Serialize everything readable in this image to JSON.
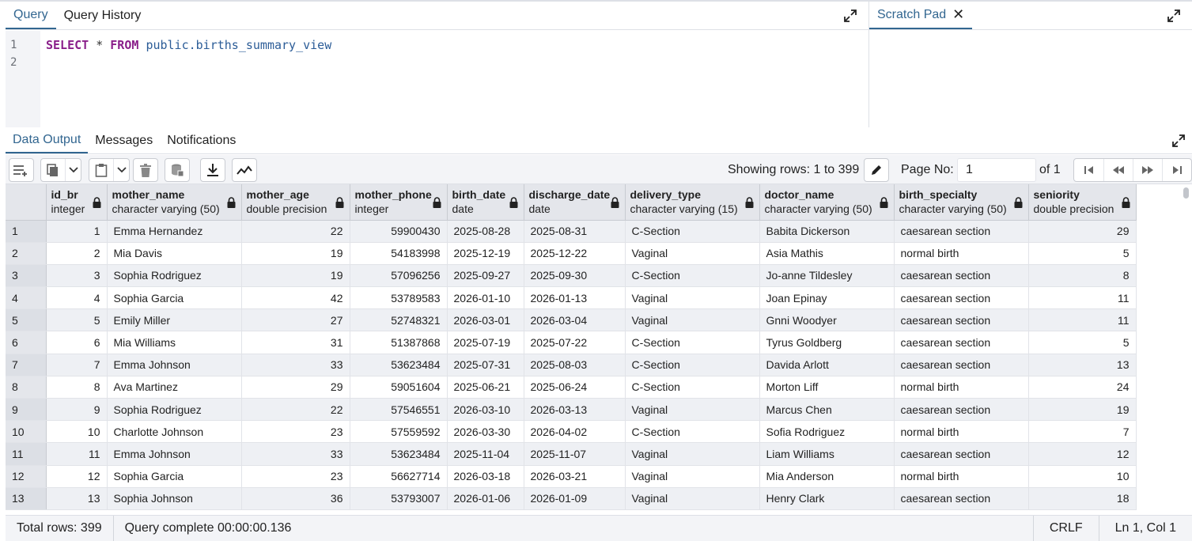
{
  "query_panel": {
    "tabs": [
      {
        "label": "Query",
        "active": true
      },
      {
        "label": "Query History",
        "active": false
      }
    ]
  },
  "scratch_panel": {
    "tab_label": "Scratch Pad"
  },
  "editor": {
    "line_numbers": [
      "1",
      "2"
    ],
    "sql_keyword_select": "SELECT",
    "sql_star": "*",
    "sql_keyword_from": "FROM",
    "sql_object": "public.births_summary_view"
  },
  "output_panel": {
    "tabs": [
      {
        "label": "Data Output",
        "active": true
      },
      {
        "label": "Messages",
        "active": false
      },
      {
        "label": "Notifications",
        "active": false
      }
    ]
  },
  "toolbar": {
    "showing_rows": "Showing rows: 1 to 399",
    "page_label": "Page No:",
    "page_value": "1",
    "of_label": "of 1"
  },
  "grid": {
    "columns": [
      {
        "name": "id_br",
        "type": "integer",
        "align": "right"
      },
      {
        "name": "mother_name",
        "type": "character varying (50)",
        "align": "left"
      },
      {
        "name": "mother_age",
        "type": "double precision",
        "align": "right"
      },
      {
        "name": "mother_phone",
        "type": "integer",
        "align": "right"
      },
      {
        "name": "birth_date",
        "type": "date",
        "align": "left"
      },
      {
        "name": "discharge_date",
        "type": "date",
        "align": "left"
      },
      {
        "name": "delivery_type",
        "type": "character varying (15)",
        "align": "left"
      },
      {
        "name": "doctor_name",
        "type": "character varying (50)",
        "align": "left"
      },
      {
        "name": "birth_specialty",
        "type": "character varying (50)",
        "align": "left"
      },
      {
        "name": "seniority",
        "type": "double precision",
        "align": "right"
      }
    ],
    "rows": [
      [
        "1",
        "1",
        "Emma Hernandez",
        "22",
        "59900430",
        "2025-08-28",
        "2025-08-31",
        "C-Section",
        "Babita Dickerson",
        "caesarean section",
        "29"
      ],
      [
        "2",
        "2",
        "Mia Davis",
        "19",
        "54183998",
        "2025-12-19",
        "2025-12-22",
        "Vaginal",
        "Asia Mathis",
        "normal birth",
        "5"
      ],
      [
        "3",
        "3",
        "Sophia Rodriguez",
        "19",
        "57096256",
        "2025-09-27",
        "2025-09-30",
        "C-Section",
        "Jo-anne Tildesley",
        "caesarean section",
        "8"
      ],
      [
        "4",
        "4",
        "Sophia Garcia",
        "42",
        "53789583",
        "2026-01-10",
        "2026-01-13",
        "Vaginal",
        "Joan Epinay",
        "caesarean section",
        "11"
      ],
      [
        "5",
        "5",
        "Emily Miller",
        "27",
        "52748321",
        "2026-03-01",
        "2026-03-04",
        "Vaginal",
        "Gnni Woodyer",
        "caesarean section",
        "11"
      ],
      [
        "6",
        "6",
        "Mia Williams",
        "31",
        "51387868",
        "2025-07-19",
        "2025-07-22",
        "C-Section",
        "Tyrus Goldberg",
        "caesarean section",
        "5"
      ],
      [
        "7",
        "7",
        "Emma Johnson",
        "33",
        "53623484",
        "2025-07-31",
        "2025-08-03",
        "C-Section",
        "Davida Arlott",
        "caesarean section",
        "13"
      ],
      [
        "8",
        "8",
        "Ava Martinez",
        "29",
        "59051604",
        "2025-06-21",
        "2025-06-24",
        "C-Section",
        "Morton Liff",
        "normal birth",
        "24"
      ],
      [
        "9",
        "9",
        "Sophia Rodriguez",
        "22",
        "57546551",
        "2026-03-10",
        "2026-03-13",
        "Vaginal",
        "Marcus Chen",
        "caesarean section",
        "19"
      ],
      [
        "10",
        "10",
        "Charlotte Johnson",
        "23",
        "57559592",
        "2026-03-30",
        "2026-04-02",
        "C-Section",
        "Sofia Rodriguez",
        "normal birth",
        "7"
      ],
      [
        "11",
        "11",
        "Emma Johnson",
        "33",
        "53623484",
        "2025-11-04",
        "2025-11-07",
        "Vaginal",
        "Liam Williams",
        "caesarean section",
        "12"
      ],
      [
        "12",
        "12",
        "Sophia Garcia",
        "23",
        "56627714",
        "2026-03-18",
        "2026-03-21",
        "Vaginal",
        "Mia Anderson",
        "normal birth",
        "10"
      ],
      [
        "13",
        "13",
        "Sophia Johnson",
        "36",
        "53793007",
        "2026-01-06",
        "2026-01-09",
        "Vaginal",
        "Henry Clark",
        "caesarean section",
        "18"
      ]
    ]
  },
  "status": {
    "total_rows": "Total rows: 399",
    "query_time": "Query complete 00:00:00.136",
    "line_ending": "CRLF",
    "cursor": "Ln 1, Col 1"
  },
  "colors": {
    "accent": "#326690",
    "sql_keyword": "#8a1f8a",
    "sql_identifier": "#2b5c97",
    "header_bg": "#e4e6eb",
    "alt_row_bg": "#eef0f4"
  }
}
